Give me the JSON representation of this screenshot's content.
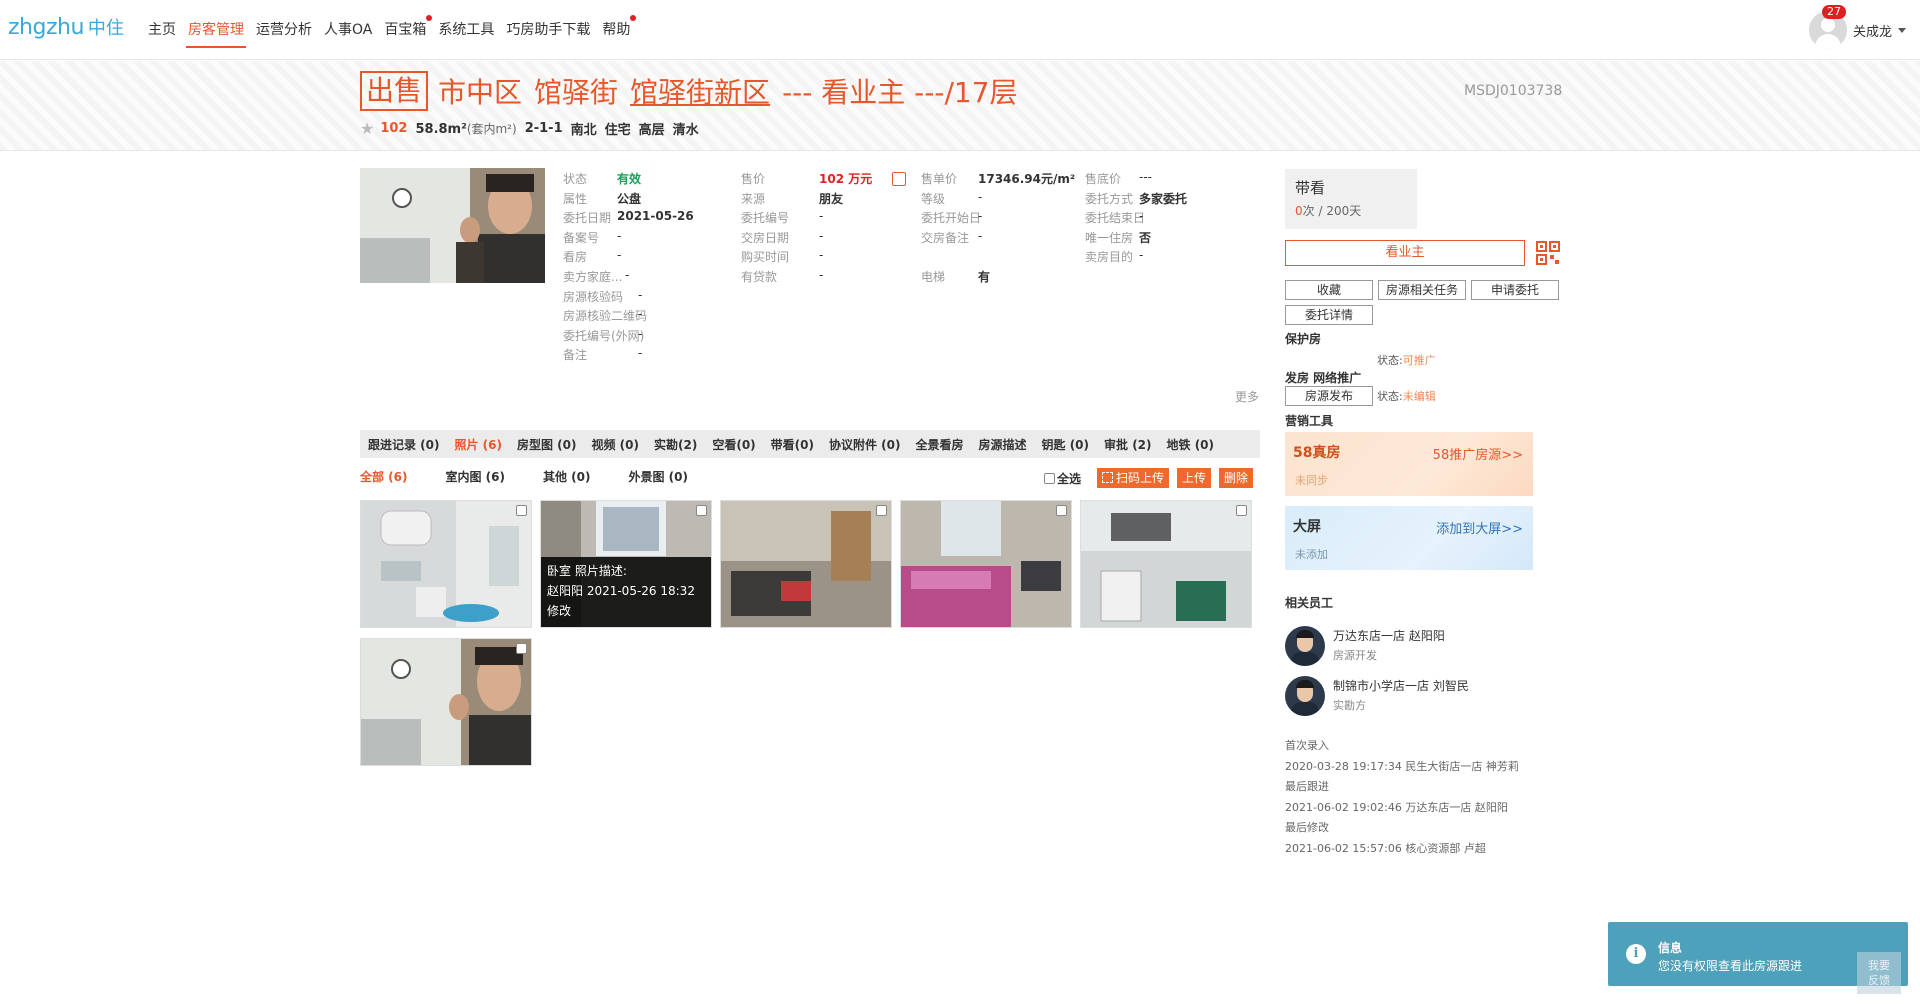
{
  "nav": {
    "logo_en": "zhgzhu",
    "logo_cn": "中住",
    "items": [
      {
        "label": "主页",
        "active": false,
        "dot": false
      },
      {
        "label": "房客管理",
        "active": true,
        "dot": false
      },
      {
        "label": "运营分析",
        "active": false,
        "dot": false
      },
      {
        "label": "人事OA",
        "active": false,
        "dot": false
      },
      {
        "label": "百宝箱",
        "active": false,
        "dot": true
      },
      {
        "label": "系统工具",
        "active": false,
        "dot": false
      },
      {
        "label": "巧房助手下载",
        "active": false,
        "dot": false
      },
      {
        "label": "帮助",
        "active": false,
        "dot": true
      }
    ],
    "badge": "27",
    "username": "关成龙"
  },
  "header": {
    "tag": "出售",
    "district": "市中区",
    "street": "馆驿街",
    "community": "馆驿街新区",
    "rest": "--- 看业主 ---/17层",
    "code": "MSDJ0103738",
    "price": "102",
    "area": "58.8m²",
    "area_note": "(套内m²)",
    "layout": "2-1-1",
    "orientation": "南北",
    "usage": "住宅",
    "floor": "高层",
    "decor": "清水"
  },
  "info": {
    "col1": [
      {
        "label": "状态",
        "value": "有效",
        "style": "green"
      },
      {
        "label": "属性",
        "value": "公盘",
        "style": "b"
      },
      {
        "label": "委托日期",
        "value": "2021-05-26",
        "style": "b"
      },
      {
        "label": "备案号",
        "value": "-",
        "style": ""
      },
      {
        "label": "看房",
        "value": "-",
        "style": ""
      },
      {
        "label": "卖方家庭...",
        "value": "-",
        "style": ""
      },
      {
        "label": "房源核验码",
        "value": "-",
        "style": ""
      },
      {
        "label": "房源核验二维码",
        "value": "-",
        "style": ""
      },
      {
        "label": "委托编号(外网)",
        "value": "-",
        "style": ""
      },
      {
        "label": "备注",
        "value": "-",
        "style": ""
      }
    ],
    "col2": [
      {
        "label": "售价",
        "value": "102 万元",
        "style": "red"
      },
      {
        "label": "来源",
        "value": "朋友",
        "style": "b"
      },
      {
        "label": "委托编号",
        "value": "-",
        "style": ""
      },
      {
        "label": "交房日期",
        "value": "-",
        "style": ""
      },
      {
        "label": "购买时间",
        "value": "-",
        "style": ""
      },
      {
        "label": "有贷款",
        "value": "-",
        "style": ""
      }
    ],
    "col3": [
      {
        "label": "售单价",
        "value": "17346.94元/m²",
        "style": "b"
      },
      {
        "label": "等级",
        "value": "-",
        "style": ""
      },
      {
        "label": "委托开始日",
        "value": "-",
        "style": ""
      },
      {
        "label": "交房备注",
        "value": "-",
        "style": ""
      },
      {
        "label": "",
        "value": "",
        "style": ""
      },
      {
        "label": "电梯",
        "value": "有",
        "style": "b"
      }
    ],
    "col4": [
      {
        "label": "售底价",
        "value": "---",
        "style": ""
      },
      {
        "label": "委托方式",
        "value": "多家委托",
        "style": "b"
      },
      {
        "label": "委托结束日",
        "value": "-",
        "style": ""
      },
      {
        "label": "唯一住房",
        "value": "否",
        "style": "b"
      },
      {
        "label": "卖房目的",
        "value": "-",
        "style": ""
      }
    ],
    "more": "更多"
  },
  "tabs": [
    {
      "label": "跟进记录 (0)",
      "active": false
    },
    {
      "label": "照片 (6)",
      "active": true
    },
    {
      "label": "房型图 (0)",
      "active": false
    },
    {
      "label": "视频 (0)",
      "active": false
    },
    {
      "label": "实勘(2)",
      "active": false
    },
    {
      "label": "空看(0)",
      "active": false
    },
    {
      "label": "带看(0)",
      "active": false
    },
    {
      "label": "协议附件 (0)",
      "active": false
    },
    {
      "label": "全景看房",
      "active": false
    },
    {
      "label": "房源描述",
      "active": false
    },
    {
      "label": "钥匙 (0)",
      "active": false
    },
    {
      "label": "审批 (2)",
      "active": false
    },
    {
      "label": "地铁 (0)",
      "active": false
    }
  ],
  "subtabs": [
    {
      "label": "全部 (6)",
      "active": true
    },
    {
      "label": "室内图 (6)",
      "active": false
    },
    {
      "label": "其他 (0)",
      "active": false
    },
    {
      "label": "外景图 (0)",
      "active": false
    }
  ],
  "toolbar": {
    "select_all": "全选",
    "scan_upload": "扫码上传",
    "upload": "上传",
    "delete": "删除"
  },
  "photo_overlay": {
    "line1": "卧室   照片描述:",
    "line2": "赵阳阳 2021-05-26 18:32",
    "line3": "修改"
  },
  "right": {
    "daikan_title": "带看",
    "daikan_count": "0",
    "daikan_rest": "次 / 200天",
    "kyz": "看业主",
    "btn_fav": "收藏",
    "btn_task": "房源相关任务",
    "btn_apply": "申请委托",
    "btn_detail": "委托详情",
    "protect_label": "保护房",
    "protect_status_label": "状态:",
    "protect_status": "可推广",
    "publish_label": "发房 网络推广",
    "publish_btn": "房源发布",
    "publish_status_label": "状态:",
    "publish_status": "未编辑",
    "marketing_label": "营销工具",
    "card58_title": "58真房",
    "card58_link": "58推广房源>>",
    "card58_status": "未同步",
    "cardbig_title": "大屏",
    "cardbig_link": "添加到大屏>>",
    "cardbig_status": "未添加",
    "staff_label": "相关员工",
    "staff": [
      {
        "name": "万达东店一店 赵阳阳",
        "role": "房源开发"
      },
      {
        "name": "制锦市小学店一店 刘智民",
        "role": "实勘方"
      }
    ],
    "logs": [
      "首次录入",
      "2020-03-28 19:17:34 民生大街店一店 神芳莉",
      "最后跟进",
      "2021-06-02 19:02:46 万达东店一店 赵阳阳",
      "最后修改",
      "2021-06-02 15:57:06 核心资源部 卢超"
    ]
  },
  "toast": {
    "title": "信息",
    "message": "您没有权限查看此房源跟进"
  },
  "feedback": {
    "line1": "我要",
    "line2": "反馈"
  }
}
